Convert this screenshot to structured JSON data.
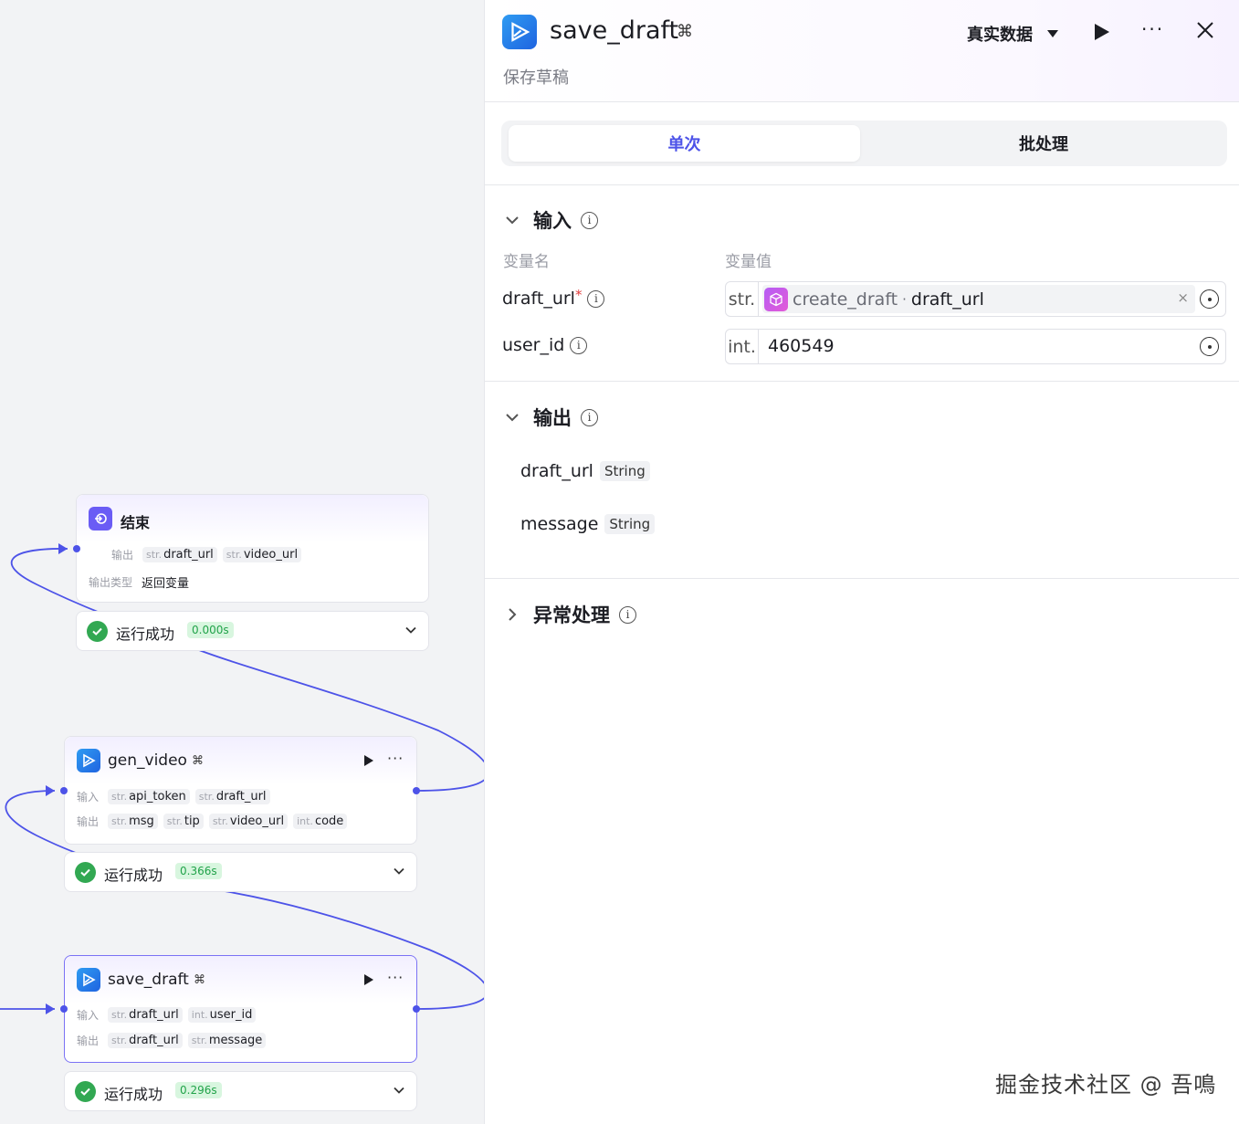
{
  "canvas": {
    "end_node": {
      "title": "结束",
      "output_label": "输出",
      "outputs": [
        {
          "type": "str.",
          "name": "draft_url"
        },
        {
          "type": "str.",
          "name": "video_url"
        }
      ],
      "output_type_label": "输出类型",
      "output_type_value": "返回变量",
      "status_text": "运行成功",
      "status_time": "0.000s"
    },
    "gen_video_node": {
      "title": "gen_video",
      "input_label": "输入",
      "output_label": "输出",
      "inputs": [
        {
          "type": "str.",
          "name": "api_token"
        },
        {
          "type": "str.",
          "name": "draft_url"
        }
      ],
      "outputs": [
        {
          "type": "str.",
          "name": "msg"
        },
        {
          "type": "str.",
          "name": "tip"
        },
        {
          "type": "str.",
          "name": "video_url"
        },
        {
          "type": "int.",
          "name": "code"
        }
      ],
      "status_text": "运行成功",
      "status_time": "0.366s"
    },
    "save_draft_node": {
      "title": "save_draft",
      "input_label": "输入",
      "output_label": "输出",
      "inputs": [
        {
          "type": "str.",
          "name": "draft_url"
        },
        {
          "type": "int.",
          "name": "user_id"
        }
      ],
      "outputs": [
        {
          "type": "str.",
          "name": "draft_url"
        },
        {
          "type": "str.",
          "name": "message"
        }
      ],
      "status_text": "运行成功",
      "status_time": "0.296s"
    }
  },
  "panel": {
    "title": "save_draft",
    "subtitle": "保存草稿",
    "mode_label": "真实数据",
    "tabs": [
      {
        "label": "单次",
        "active": true
      },
      {
        "label": "批处理",
        "active": false
      }
    ],
    "input_section": {
      "title": "输入",
      "col_name": "变量名",
      "col_value": "变量值",
      "rows": [
        {
          "name": "draft_url",
          "required": "*",
          "type": "str.",
          "ref_node": "create_draft",
          "ref_sep": "·",
          "ref_field": "draft_url",
          "clear": "×"
        },
        {
          "name": "user_id",
          "type": "int.",
          "value": "460549"
        }
      ]
    },
    "output_section": {
      "title": "输出",
      "rows": [
        {
          "name": "draft_url",
          "type": "String"
        },
        {
          "name": "message",
          "type": "String"
        }
      ]
    },
    "exception_section": {
      "title": "异常处理"
    }
  },
  "watermark": "掘金技术社区 @ 吾鳴",
  "colors": {
    "accent": "#4d53e8",
    "success": "#32a852",
    "plugin_icon": "#1f63e0",
    "end_icon": "#6a5cf5"
  }
}
